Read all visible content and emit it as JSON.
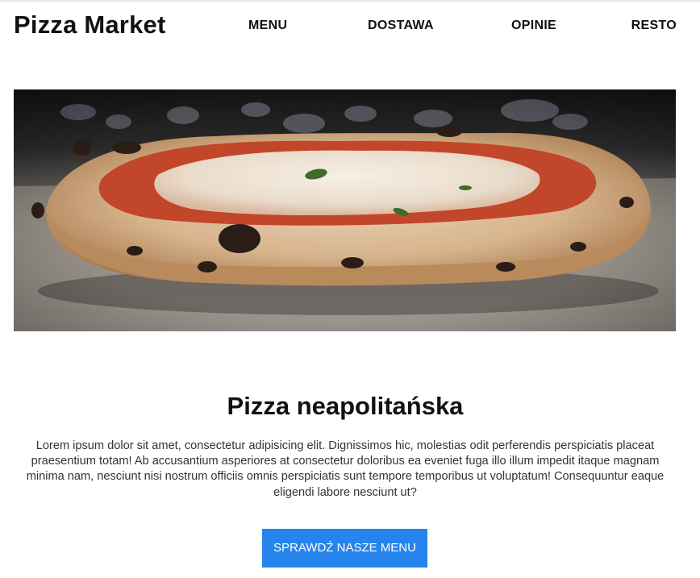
{
  "header": {
    "brand": "Pizza Market",
    "nav": [
      "MENU",
      "DOSTAWA",
      "OPINIE",
      "RESTO"
    ]
  },
  "hero": {
    "image_alt": "Pizza neapolitańska z pieca"
  },
  "main": {
    "title": "Pizza neapolitańska",
    "description": "Lorem ipsum dolor sit amet, consectetur adipisicing elit. Dignissimos hic, molestias odit perferendis perspiciatis placeat praesentium totam! Ab accusantium asperiores at consectetur doloribus ea eveniet fuga illo illum impedit itaque magnam minima nam, nesciunt nisi nostrum officiis omnis perspiciatis sunt tempore temporibus ut voluptatum! Consequuntur eaque eligendi labore nesciunt ut?",
    "cta_label": "SPRAWDŹ NASZE MENU"
  },
  "colors": {
    "accent": "#2585ec",
    "text": "#111111"
  }
}
